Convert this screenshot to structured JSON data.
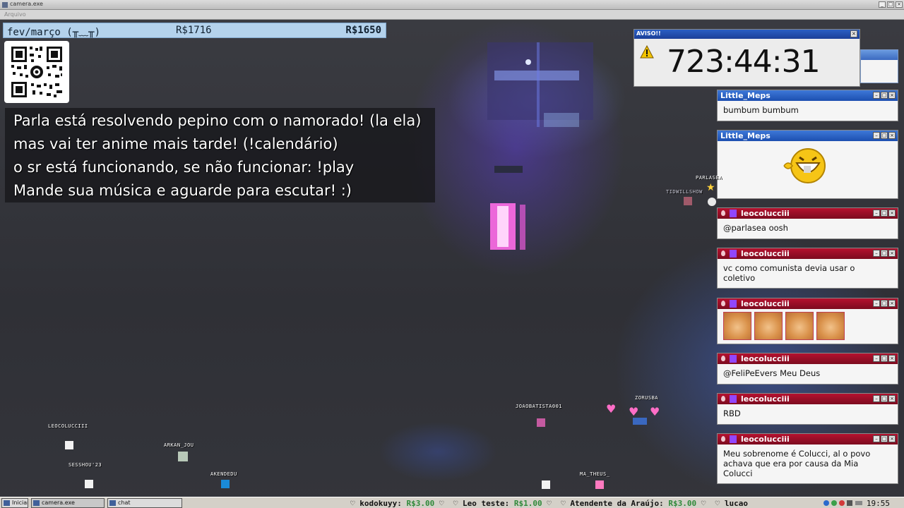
{
  "window": {
    "title": "camera.exe",
    "menu": "Arquivo"
  },
  "price_bar": {
    "label": "fev/março (╥﹏╥)",
    "price_1": "R$1716",
    "price_2": "R$1650"
  },
  "overlay": {
    "lines": [
      "Parla está resolvendo pepino com o namorado! (la ela)",
      "mas vai ter anime mais tarde! (!calendário)",
      "o sr está funcionando, se não funcionar: !play",
      "Mande sua música e aguarde para escutar! :)"
    ]
  },
  "warning": {
    "title": "AVISO!!",
    "timer": "723:44:31",
    "icon": "warning-triangle-icon"
  },
  "chat": [
    {
      "user": "Little_Meps",
      "text": "bumbum bumbum",
      "style": "blue"
    },
    {
      "user": "Little_Meps",
      "text": "",
      "style": "blue",
      "emote": "grinning-face-emote"
    },
    {
      "user": "leocolucciii",
      "text": "@parlasea oosh",
      "style": "red"
    },
    {
      "user": "leocolucciii",
      "text": "vc como comunista devia usar o coletivo",
      "style": "red"
    },
    {
      "user": "leocolucciii",
      "text": "",
      "style": "red",
      "emote": "doge-emote"
    },
    {
      "user": "leocolucciii",
      "text": "@FeliPeEvers Meu Deus",
      "style": "red"
    },
    {
      "user": "leocolucciii",
      "text": "RBD",
      "style": "red"
    },
    {
      "user": "leocolucciii",
      "text": "Meu sobrenome é Colucci, al o povo achava que era por causa da Mia Colucci",
      "style": "red"
    }
  ],
  "avatars": {
    "parlasea": "PARLASEA",
    "tidwillshow": "TIDWILLSHOW",
    "leocolucciii": "LEOCOLUCCIII",
    "sesshou": "SESSHOU'23",
    "arkan": "ARKAN_JOU",
    "akendedu": "AKENDEDU",
    "joaobatista": "JOAOBATISTA001",
    "zorusba": "ZORUSBA",
    "matheus": "MA_THEUS_"
  },
  "taskbar": {
    "start": "Iniciar",
    "app1": "camera.exe",
    "app2": "chat",
    "ticker": [
      {
        "name": "kodokuyy:",
        "amount": "R$3.00"
      },
      {
        "name": "Leo teste:",
        "amount": "R$1.00"
      },
      {
        "name": "Atendente da Araújo:",
        "amount": "R$3.00"
      },
      {
        "name": "lucao",
        "amount": ""
      }
    ],
    "clock": "19:55"
  },
  "colors": {
    "price_bar_bg": "#b4d2ec",
    "chat_blue_header": "#1d4fb0",
    "chat_red_header": "#9a0e26",
    "donation_amount": "#2f8a3a"
  }
}
